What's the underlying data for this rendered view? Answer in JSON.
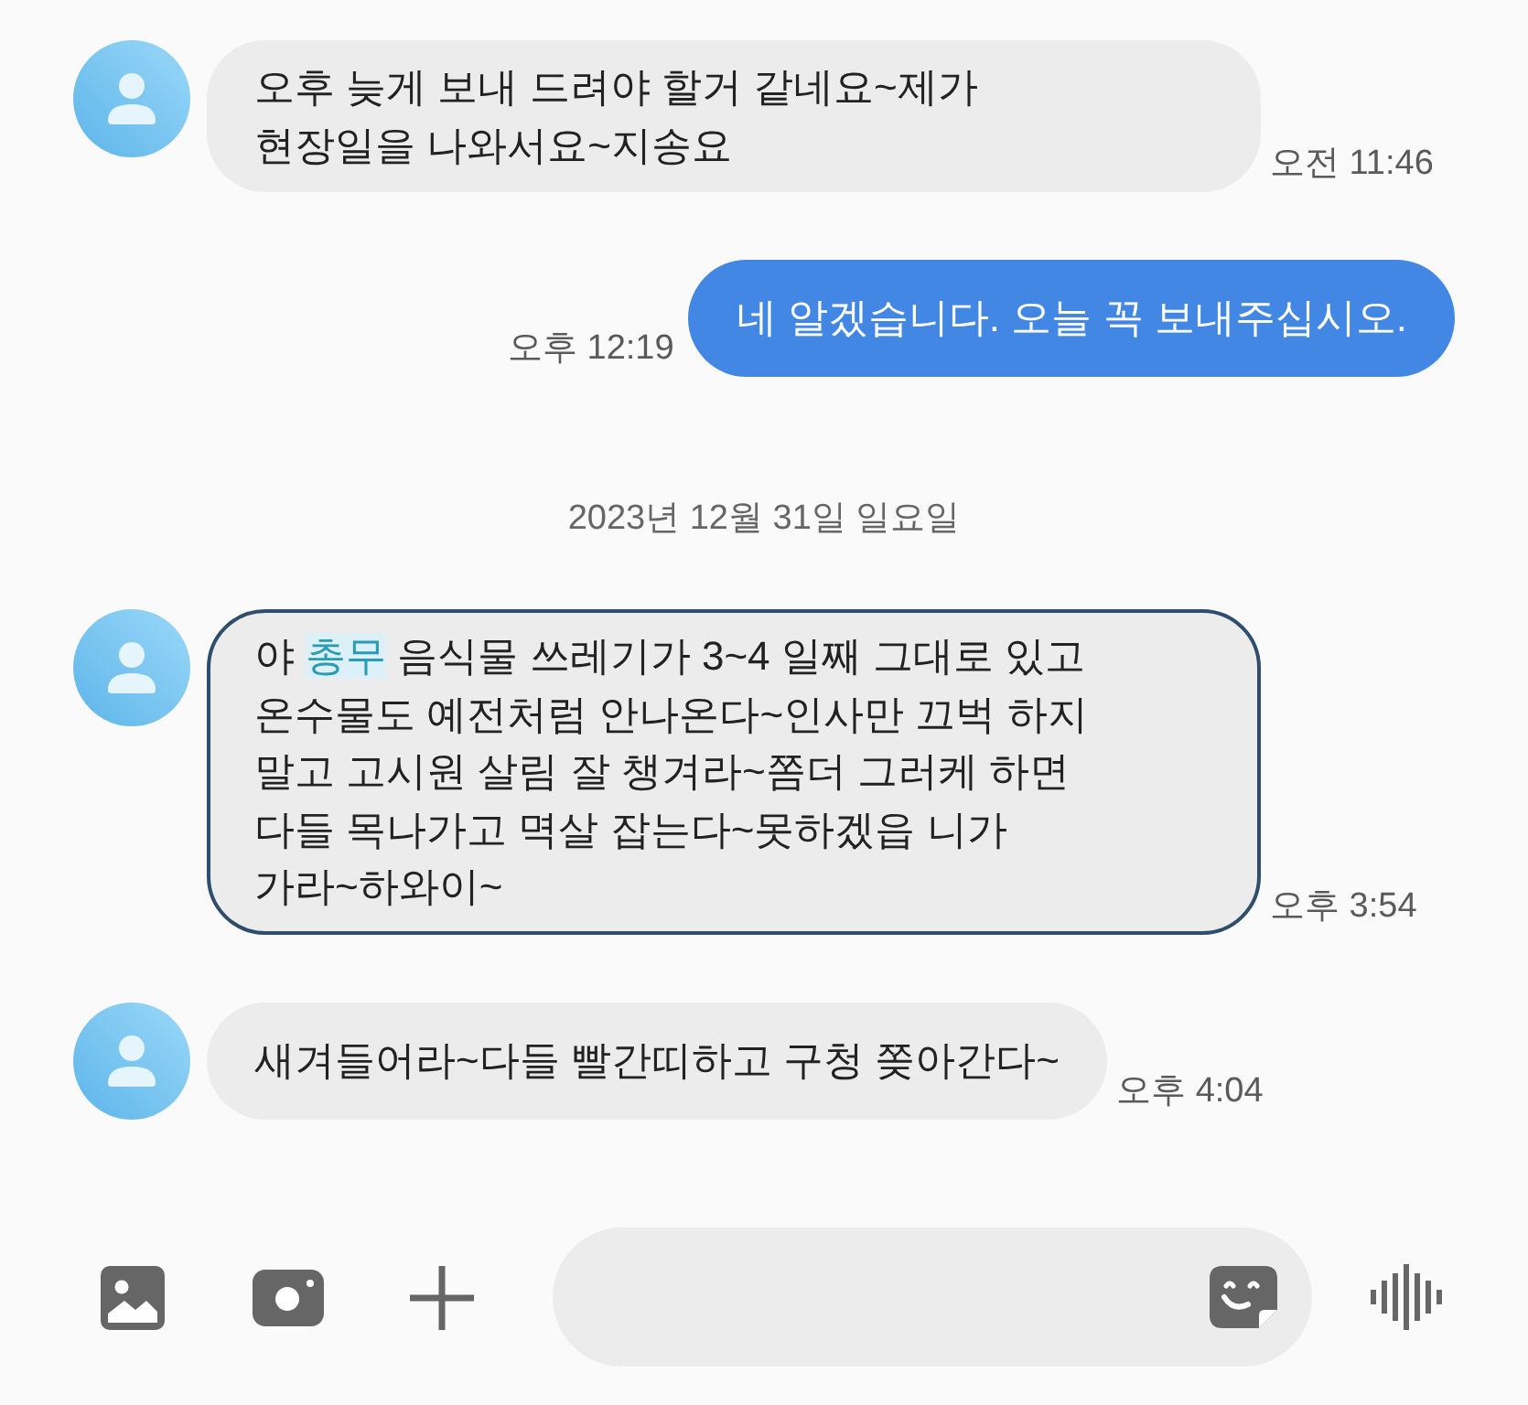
{
  "conversation": [
    {
      "kind": "received",
      "selected": false,
      "lines": [
        [
          {
            "text": "오후 늦게 보내 드려야 할거 같네요~제가",
            "highlighted": false
          }
        ],
        [
          {
            "text": "현장일을 나와서요~지송요",
            "highlighted": false
          }
        ]
      ],
      "time": "오전 11:46"
    },
    {
      "kind": "sent",
      "selected": false,
      "lines": [
        [
          {
            "text": "네 알겠습니다. 오늘 꼭 보내주십시오.",
            "highlighted": false
          }
        ]
      ],
      "time": "오후 12:19"
    },
    {
      "kind": "date",
      "text": "2023년 12월 31일 일요일"
    },
    {
      "kind": "received",
      "selected": true,
      "lines": [
        [
          {
            "text": "야 ",
            "highlighted": false
          },
          {
            "text": "총무",
            "highlighted": true
          },
          {
            "text": " 음식물 쓰레기가 3~4 일째 그대로 있고",
            "highlighted": false
          }
        ],
        [
          {
            "text": "온수물도 예전처럼 안나온다~인사만 끄벅 하지",
            "highlighted": false
          }
        ],
        [
          {
            "text": "말고 고시원 살림 잘 챙겨라~쫌더 그러케 하면",
            "highlighted": false
          }
        ],
        [
          {
            "text": "다들 목나가고 멱살 잡는다~못하겠읍 니가",
            "highlighted": false
          }
        ],
        [
          {
            "text": "가라~하와이~",
            "highlighted": false
          }
        ]
      ],
      "time": "오후 3:54"
    },
    {
      "kind": "received",
      "selected": false,
      "lines": [
        [
          {
            "text": "새겨들어라~다들 빨간띠하고 구청 쫒아간다~",
            "highlighted": false
          }
        ]
      ],
      "time": "오후 4:04"
    }
  ]
}
